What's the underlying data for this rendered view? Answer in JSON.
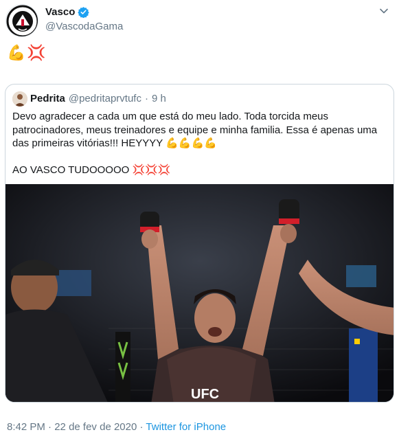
{
  "account": {
    "display_name": "Vasco",
    "handle": "@VascodaGama",
    "verified": true,
    "avatar_icon": "vasco-crest-icon"
  },
  "tweet": {
    "text": "💪💢"
  },
  "quoted": {
    "display_name": "Pedrita",
    "handle": "@pedritaprvtufc",
    "separator": "·",
    "age": "9 h",
    "body": "Devo agradecer a cada um que está do meu lado. Toda torcida meus patrocinadores, meus treinadores e equipe e minha familia. Essa é apenas uma das primeiras vitórias!!! HEYYYY 💪💪💪💪\n\nAO VASCO TUDOOOOO 💢💢💢",
    "photo_logo": "UFC"
  },
  "footer": {
    "time": "8:42 PM",
    "separator1": "·",
    "date": "22 de fev de 2020",
    "separator2": "·",
    "source": "Twitter for iPhone"
  },
  "colors": {
    "link": "#1b95e0",
    "verified": "#1da1f2",
    "muted": "#657786",
    "border": "#ccd6dd"
  }
}
